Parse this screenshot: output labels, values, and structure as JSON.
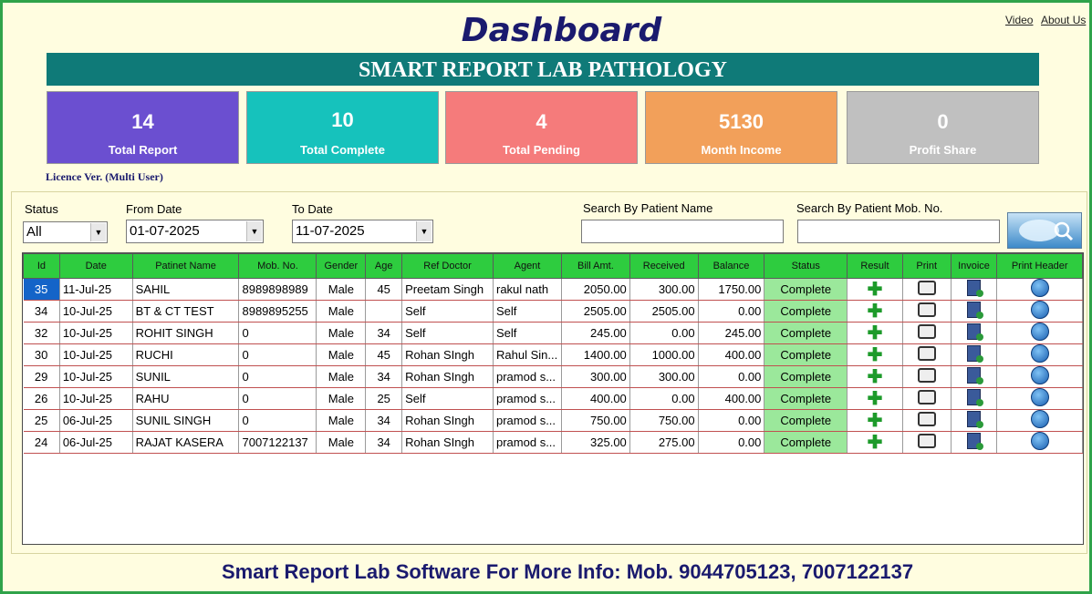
{
  "header": {
    "title": "Dashboard",
    "video_link": "Video",
    "about_link": "About Us"
  },
  "banner": "SMART REPORT LAB PATHOLOGY",
  "cards": [
    {
      "value": "14",
      "label": "Total Report",
      "color": "#6b4fd0"
    },
    {
      "value": "10",
      "label": "Total Complete",
      "color": "#16c2bc"
    },
    {
      "value": "4",
      "label": "Total Pending",
      "color": "#f57b7b"
    },
    {
      "value": "5130",
      "label": "Month Income",
      "color": "#f2a05a"
    },
    {
      "value": "0",
      "label": "Profit Share",
      "color": "#c0c0c0"
    }
  ],
  "licence": "Licence Ver. (Multi User)",
  "filters": {
    "status_label": "Status",
    "status_value": "All",
    "from_label": "From Date",
    "from_value": "01-07-2025",
    "to_label": "To Date",
    "to_value": "11-07-2025",
    "search_name_label": "Search By Patient Name",
    "search_mob_label": "Search By Patient Mob. No."
  },
  "table": {
    "columns": [
      "Id",
      "Date",
      "Patinet Name",
      "Mob. No.",
      "Gender",
      "Age",
      "Ref Doctor",
      "Agent",
      "Bill Amt.",
      "Received",
      "Balance",
      "Status",
      "Result",
      "Print",
      "Invoice",
      "Print Header"
    ],
    "rows": [
      [
        "35",
        "11-Jul-25",
        "SAHIL",
        "8989898989",
        "Male",
        "45",
        "Preetam Singh",
        "rakul nath",
        "2050.00",
        "300.00",
        "1750.00",
        "Complete"
      ],
      [
        "34",
        "10-Jul-25",
        "BT & CT TEST",
        "8989895255",
        "Male",
        "",
        "Self",
        "Self",
        "2505.00",
        "2505.00",
        "0.00",
        "Complete"
      ],
      [
        "32",
        "10-Jul-25",
        "ROHIT SINGH",
        "0",
        "Male",
        "34",
        "Self",
        "Self",
        "245.00",
        "0.00",
        "245.00",
        "Complete"
      ],
      [
        "30",
        "10-Jul-25",
        "RUCHI",
        "0",
        "Male",
        "45",
        "Rohan SIngh",
        "Rahul Sin...",
        "1400.00",
        "1000.00",
        "400.00",
        "Complete"
      ],
      [
        "29",
        "10-Jul-25",
        "SUNIL",
        "0",
        "Male",
        "34",
        "Rohan SIngh",
        "pramod s...",
        "300.00",
        "300.00",
        "0.00",
        "Complete"
      ],
      [
        "26",
        "10-Jul-25",
        "RAHU",
        "0",
        "Male",
        "25",
        "Self",
        "pramod s...",
        "400.00",
        "0.00",
        "400.00",
        "Complete"
      ],
      [
        "25",
        "06-Jul-25",
        "SUNIL SINGH",
        "0",
        "Male",
        "34",
        "Rohan SIngh",
        "pramod s...",
        "750.00",
        "750.00",
        "0.00",
        "Complete"
      ],
      [
        "24",
        "06-Jul-25",
        "RAJAT KASERA",
        "7007122137",
        "Male",
        "34",
        "Rohan SIngh",
        "pramod s...",
        "325.00",
        "275.00",
        "0.00",
        "Complete"
      ]
    ]
  },
  "footer": "Smart Report Lab Software For More Info: Mob. 9044705123, 7007122137"
}
